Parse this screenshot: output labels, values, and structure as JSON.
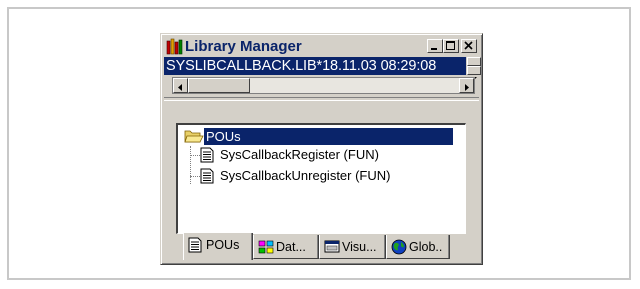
{
  "window": {
    "title": "Library Manager",
    "library_entry": "SYSLIBCALLBACK.LIB*18.11.03 08:29:08"
  },
  "tree": {
    "root": "POUs",
    "children": [
      {
        "label": "SysCallbackRegister (FUN)"
      },
      {
        "label": "SysCallbackUnregister (FUN)"
      }
    ]
  },
  "tabs": [
    {
      "label": "POUs",
      "icon": "document-icon",
      "active": true
    },
    {
      "label": "Dat...",
      "icon": "data-types-icon",
      "active": false
    },
    {
      "label": "Visu...",
      "icon": "visualization-icon",
      "active": false
    },
    {
      "label": "Glob..",
      "icon": "globe-icon",
      "active": false
    }
  ],
  "colors": {
    "selection": "#0a246a",
    "title_text": "#0a246a",
    "face": "#d4d0c8"
  }
}
